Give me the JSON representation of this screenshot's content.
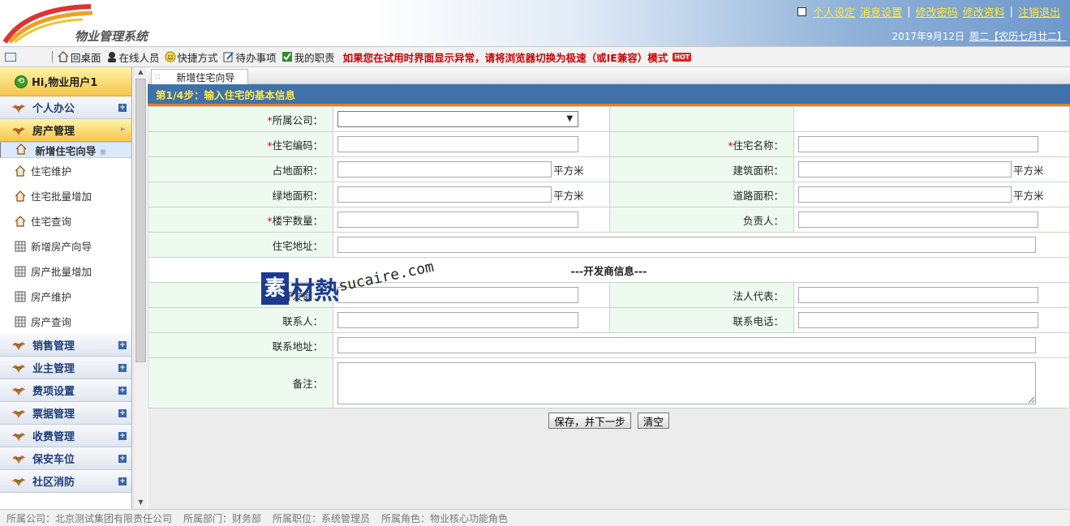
{
  "header": {
    "app_title": "物业管理系统",
    "links": [
      "个人设定",
      "消息设置",
      "修改密码",
      "修改资料",
      "注销退出"
    ],
    "date": "2017年9月12日",
    "weekday": "周二",
    "lunar": "【农历七月廿二】"
  },
  "toolbar": {
    "items": [
      {
        "label": "回桌面",
        "icon": "home-icon"
      },
      {
        "label": "在线人员",
        "icon": "users-icon"
      },
      {
        "label": "快捷方式",
        "icon": "smiley-icon"
      },
      {
        "label": "待办事项",
        "icon": "edit-icon"
      },
      {
        "label": "我的职责",
        "icon": "check-icon"
      }
    ],
    "warning": "如果您在试用时界面显示异常，请将浏览器切换为极速（或IE兼容）模式",
    "hot_badge": "HOT"
  },
  "sidebar": {
    "greeting": "Hi,物业用户1",
    "groups_top": [
      {
        "label": "个人办公",
        "active": false
      },
      {
        "label": "房产管理",
        "active": true
      }
    ],
    "sub_items": [
      {
        "label": "新增住宅向导",
        "icon": "house-icon",
        "selected": true
      },
      {
        "label": "住宅维护",
        "icon": "house-icon",
        "selected": false
      },
      {
        "label": "住宅批量增加",
        "icon": "house-icon",
        "selected": false
      },
      {
        "label": "住宅查询",
        "icon": "house-icon",
        "selected": false
      },
      {
        "label": "新增房产向导",
        "icon": "building-icon",
        "selected": false
      },
      {
        "label": "房产批量增加",
        "icon": "building-icon",
        "selected": false
      },
      {
        "label": "房产维护",
        "icon": "building-icon",
        "selected": false
      },
      {
        "label": "房产查询",
        "icon": "building-icon",
        "selected": false
      }
    ],
    "groups_bottom": [
      "销售管理",
      "业主管理",
      "费项设置",
      "票据管理",
      "收费管理",
      "保安车位",
      "社区消防"
    ]
  },
  "main": {
    "tab_label": "新增住宅向导",
    "step_title": "第1/4步：输入住宅的基本信息",
    "fields": {
      "company": "所属公司：",
      "code": "住宅编码：",
      "name": "住宅名称：",
      "land_area": "占地面积：",
      "building_area": "建筑面积：",
      "green_area": "绿地面积：",
      "road_area": "道路面积：",
      "building_count": "楼宇数量：",
      "manager": "负责人：",
      "address": "住宅地址：",
      "developer_name": "开发商：",
      "legal_rep": "法人代表：",
      "contact": "联系人：",
      "contact_phone": "联系电话：",
      "contact_address": "联系地址：",
      "remark": "备注："
    },
    "unit": "平方米",
    "section_title": "---开发商信息---",
    "buttons": {
      "save_next": "保存，并下一步",
      "clear": "清空"
    }
  },
  "status_bar": [
    "所属公司：北京测试集团有限责任公司",
    "所属部门：财务部",
    "所属职位：系统管理员",
    "所属角色：物业核心功能角色"
  ],
  "watermark": {
    "brand": "素材熱",
    "site": "sucaire.com"
  },
  "colors": {
    "accent_blue": "#3f72aa",
    "step_text": "#ffe54a",
    "link_yellow": "#ffeb3b",
    "warning_red": "#cc0000"
  }
}
